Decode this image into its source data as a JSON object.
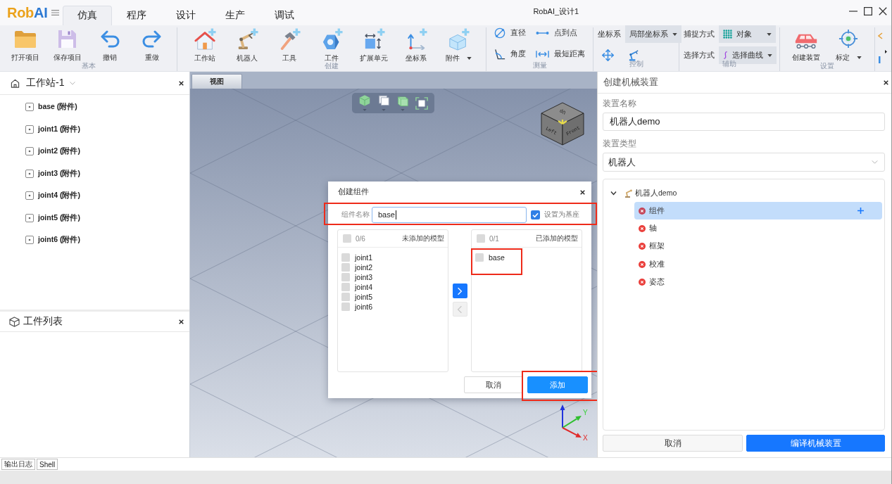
{
  "title_bar": {
    "logo": [
      {
        "text": "Rob",
        "color": "#eba21c"
      },
      {
        "text": "AI",
        "color": "#2c79d3"
      }
    ],
    "tabs": [
      {
        "label": "仿真",
        "selected": true
      },
      {
        "label": "程序",
        "selected": false
      },
      {
        "label": "设计",
        "selected": false
      },
      {
        "label": "生产",
        "selected": false
      },
      {
        "label": "调试",
        "selected": false
      }
    ],
    "window_title": "RobAI_设计1"
  },
  "ribbon": {
    "groups": [
      {
        "title": "基本",
        "items": [
          {
            "kind": "large",
            "label": "打开项目",
            "has_menu": false
          },
          {
            "kind": "large",
            "label": "保存项目",
            "has_menu": false
          },
          {
            "kind": "large",
            "label": "撤销",
            "has_menu": false
          },
          {
            "kind": "large",
            "label": "重做",
            "has_menu": false
          }
        ]
      },
      {
        "title": "创建",
        "items": [
          {
            "kind": "large",
            "label": "工作站",
            "has_menu": false
          },
          {
            "kind": "large",
            "label": "机器人",
            "has_menu": false
          },
          {
            "kind": "large",
            "label": "工具",
            "has_menu": false
          },
          {
            "kind": "large",
            "label": "工件",
            "has_menu": false
          },
          {
            "kind": "large",
            "label": "扩展单元",
            "has_menu": false
          },
          {
            "kind": "large",
            "label": "坐标系",
            "has_menu": false
          },
          {
            "kind": "large",
            "label": "附件",
            "has_menu": true
          }
        ]
      },
      {
        "title": "测量",
        "items": [
          {
            "kind": "small",
            "label": "直径"
          },
          {
            "kind": "small",
            "label": "点到点"
          },
          {
            "kind": "small",
            "label": "角度"
          },
          {
            "kind": "small",
            "label": "最短距离"
          }
        ]
      },
      {
        "title": "控制",
        "items": [
          {
            "kind": "combo",
            "label": "坐标系",
            "value": "局部坐标系"
          },
          {
            "kind": "icon"
          },
          {
            "kind": "icon"
          }
        ]
      },
      {
        "title": "辅助",
        "items": [
          {
            "kind": "combo",
            "label": "捕捉方式",
            "value": "对象"
          },
          {
            "kind": "combo",
            "label": "选择方式",
            "value": "选择曲线"
          }
        ]
      },
      {
        "title": "设置",
        "items": [
          {
            "kind": "large",
            "label": "创建装置",
            "has_menu": false
          },
          {
            "kind": "large",
            "label": "标定",
            "has_menu": true
          }
        ]
      }
    ]
  },
  "station_panel": {
    "title": "工作站-1",
    "items": [
      "base (附件)",
      "joint1 (附件)",
      "joint2 (附件)",
      "joint3 (附件)",
      "joint4 (附件)",
      "joint5 (附件)",
      "joint6 (附件)"
    ]
  },
  "workpiece_panel": {
    "title": "工件列表"
  },
  "viewport": {
    "tab": "视图",
    "cube_faces": [
      "Up",
      "Left",
      "Front"
    ],
    "axis_labels": [
      "Y",
      "X"
    ]
  },
  "dialog": {
    "title": "创建组件",
    "name_row": {
      "highlighted": true,
      "label": "组件名称",
      "value": "base",
      "set_as_base": {
        "label": "设置为基座",
        "checked": true
      }
    },
    "source_list": {
      "all_checked": false,
      "count": "0/6",
      "title": "未添加的模型",
      "items": [
        {
          "label": "joint1",
          "checked": false,
          "highlighted": false
        },
        {
          "label": "joint2",
          "checked": false,
          "highlighted": false
        },
        {
          "label": "joint3",
          "checked": false,
          "highlighted": false
        },
        {
          "label": "joint4",
          "checked": false,
          "highlighted": false
        },
        {
          "label": "joint5",
          "checked": false,
          "highlighted": false
        },
        {
          "label": "joint6",
          "checked": false,
          "highlighted": false
        }
      ]
    },
    "move_buttons": [
      {
        "kind": "right",
        "disabled": false
      },
      {
        "kind": "left",
        "disabled": true
      }
    ],
    "target_list": {
      "all_checked": false,
      "count": "0/1",
      "title": "已添加的模型",
      "items": [
        {
          "label": "base",
          "checked": false,
          "highlighted": true
        }
      ]
    },
    "buttons": [
      {
        "kind": "secondary",
        "label": "取消",
        "highlighted": false
      },
      {
        "kind": "primary",
        "label": "添加",
        "highlighted": true
      }
    ]
  },
  "device_panel": {
    "title": "创建机械装置",
    "name_label": "装置名称",
    "name_value": "机器人demo",
    "type_label": "装置类型",
    "type_value": "机器人",
    "tree": {
      "label": "机器人demo",
      "expanded": true,
      "children": [
        {
          "label": "组件",
          "selected": true
        },
        {
          "label": "轴",
          "selected": false
        },
        {
          "label": "框架",
          "selected": false
        },
        {
          "label": "校准",
          "selected": false
        },
        {
          "label": "姿态",
          "selected": false
        }
      ]
    },
    "buttons": [
      {
        "kind": "secondary",
        "label": "取消"
      },
      {
        "kind": "primary",
        "label": "编译机械装置"
      }
    ]
  },
  "bottom_tabs": [
    {
      "label": "输出日志",
      "selected": false
    },
    {
      "label": "Shell",
      "selected": false
    }
  ]
}
